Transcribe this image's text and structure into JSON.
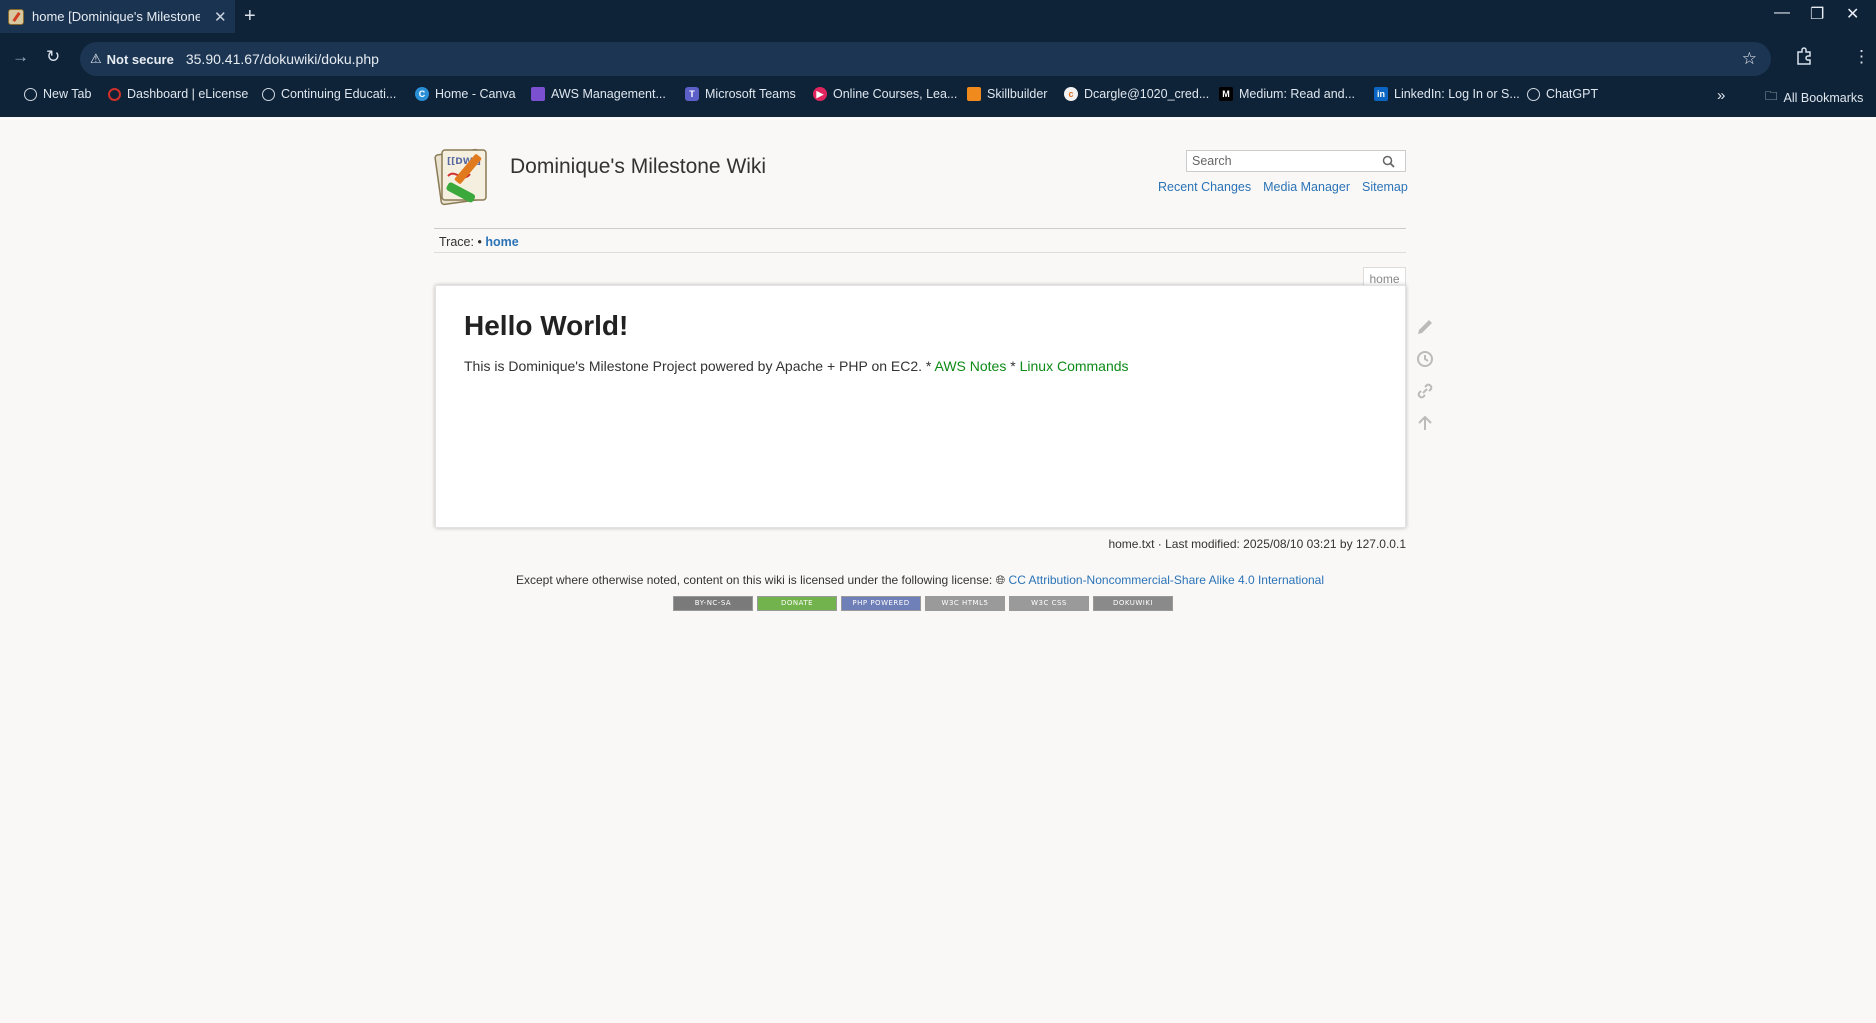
{
  "browser": {
    "tab": {
      "title": "home [Dominique's Milestone Wiki]"
    },
    "address": {
      "security_label": "Not secure",
      "url": "35.90.41.67/dokuwiki/doku.php"
    },
    "bookmarks": [
      {
        "label": "New Tab",
        "icon": "globe-icon"
      },
      {
        "label": "Dashboard | eLicense",
        "icon": "circle-icon"
      },
      {
        "label": "Continuing Educati...",
        "icon": "globe-icon"
      },
      {
        "label": "Home - Canva",
        "icon": "canva-icon"
      },
      {
        "label": "AWS Management...",
        "icon": "cube-icon"
      },
      {
        "label": "Microsoft Teams",
        "icon": "teams-icon"
      },
      {
        "label": "Online Courses, Lea...",
        "icon": "play-icon"
      },
      {
        "label": "Skillbuilder",
        "icon": "hexagon-icon"
      },
      {
        "label": "Dcargle@1020_cred...",
        "icon": "credly-icon"
      },
      {
        "label": "Medium: Read and...",
        "icon": "medium-icon"
      },
      {
        "label": "LinkedIn: Log In or S...",
        "icon": "linkedin-icon"
      },
      {
        "label": "ChatGPT",
        "icon": "openai-icon"
      }
    ],
    "all_bookmarks_label": "All Bookmarks"
  },
  "wiki": {
    "title": "Dominique's Milestone Wiki",
    "search_placeholder": "Search",
    "toplinks": {
      "recent": "Recent Changes",
      "media": "Media Manager",
      "sitemap": "Sitemap"
    },
    "trace": {
      "label": "Trace:",
      "bullet": "•",
      "crumb": "home"
    },
    "page_id": "home",
    "heading": "Hello World!",
    "body": {
      "text": "This is Dominique's Milestone Project powered by Apache + PHP on EC2.",
      "sep1": " * ",
      "link1": "AWS Notes",
      "sep2": " * ",
      "link2": "Linux Commands"
    },
    "docinfo": "home.txt · Last modified: 2025/08/10 03:21 by 127.0.0.1",
    "license": {
      "text": "Except where otherwise noted, content on this wiki is licensed under the following license:",
      "link": "CC Attribution-Noncommercial-Share Alike 4.0 International"
    },
    "badges": [
      {
        "label": "BY-NC-SA",
        "color": "#7a7a7a"
      },
      {
        "label": "DONATE",
        "color": "#73b34d"
      },
      {
        "label": "PHP POWERED",
        "color": "#6f7fb7"
      },
      {
        "label": "W3C HTML5",
        "color": "#9a9a9a"
      },
      {
        "label": "W3C CSS",
        "color": "#9a9a9a"
      },
      {
        "label": "DOKUWIKI",
        "color": "#8a8a8a"
      }
    ]
  },
  "colors": {
    "chrome_bg": "#0e2338",
    "link_blue": "#2b73b7",
    "link_green": "#0e8a16",
    "page_bg": "#f9f8f6"
  }
}
